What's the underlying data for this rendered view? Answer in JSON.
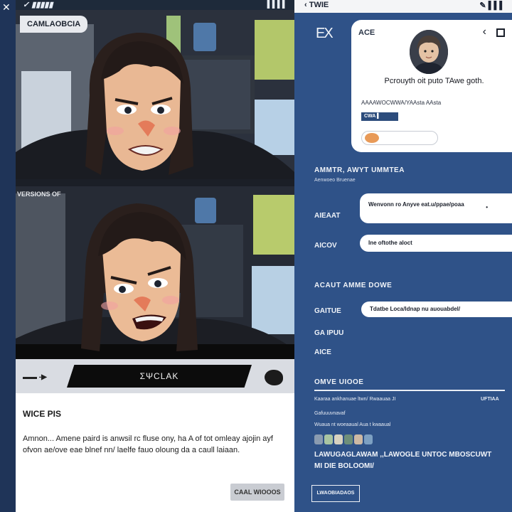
{
  "left": {
    "status": "✓ ▮▮▮▮▮",
    "signal": "▌▌▌▌",
    "chip": "CAMLAOBCIA",
    "panel2_label": "VERSIONS OF",
    "caption": {
      "icon": "▬▬ -▶",
      "banner": "ΣΨCLAK"
    },
    "text": {
      "title": "WICE PIS",
      "body": "Amnon... Amene paird is anwsil rc fluse ony, ha A of tot omleay ajojin ayf ofvon ae/ove eae blnef nn/ laelfe fauo oloung da a caull laiaan.",
      "button": "CAAL WIOOOS"
    }
  },
  "right": {
    "top_back": "‹ TWIE",
    "top_signal": "✎ ▌▌▌",
    "close": "EX",
    "card": {
      "name": "ACE",
      "back": "‹",
      "bio": "Pcrouyth oit puto TAwe goth.",
      "meta": "AAAAWOCWWA/YAAsta AAsta",
      "tag": "CWA ▌",
      "accent": "#e89a58"
    },
    "section1": {
      "title": "AMMTR, AWYT UMMTEA",
      "subtitle": "Aenwoeo Bruenae"
    },
    "rows": [
      {
        "label": "AIEAAT",
        "value": "Wenvonn ro Anyve eat.u/ppae/poaa",
        "dot": "•"
      },
      {
        "label": "AICOV",
        "value": "Ine oftothe aloct"
      }
    ],
    "section2": {
      "title": "ACAUT AMME DOWE"
    },
    "rows2": [
      {
        "label": "GAITUE",
        "value": "Tdatbe Loca/ldnap nu auouabdel/"
      },
      {
        "label": "GA IPUU"
      },
      {
        "label": "AICE"
      }
    ],
    "section3": {
      "title": "OMVE UIOOE"
    },
    "list": [
      {
        "text": "Kaaraa ankhanuae ltwn/ Rwaauaa JI",
        "right": "UFTIAA"
      },
      {
        "text": "Gafuuuvnavaf"
      },
      {
        "text": "Wuaua nt woeaaual Aua t kwaaual"
      }
    ],
    "swatch_colors": [
      "#8a9bb0",
      "#a9c4a2",
      "#d8d2c0",
      "#6f8f7a",
      "#cdb9a4",
      "#7da0c2"
    ],
    "big_lines": [
      "LAWUGAGLAWAM ,,LAWOGLE UNTOC MBOSCUWT",
      "MI DIE BOLOOMI/"
    ],
    "button": "LWAOBIADAOS"
  }
}
